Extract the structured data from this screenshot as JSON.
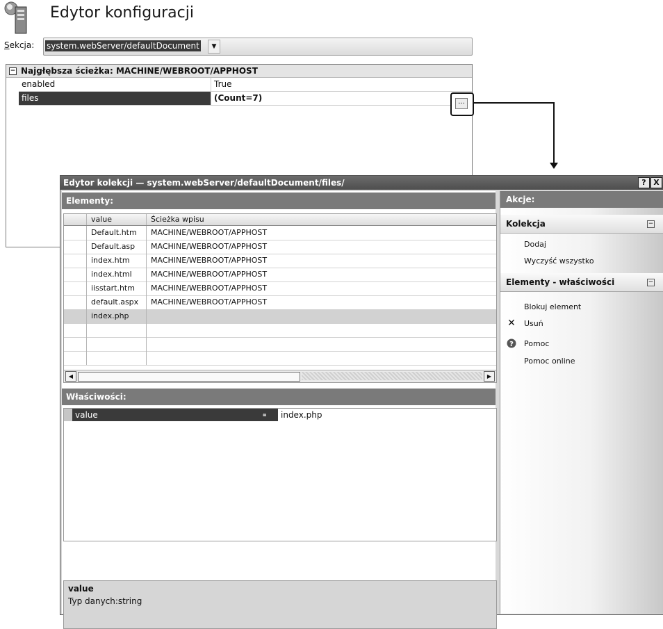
{
  "editor": {
    "title": "Edytor konfiguracji",
    "section_label_accel": "S",
    "section_label_rest": "ekcja:",
    "section_value": "system.webServer/defaultDocument",
    "tree_header": "Najgłębsza ścieżka: MACHINE/WEBROOT/APPHOST",
    "rows": [
      {
        "key": "enabled",
        "value": "True"
      },
      {
        "key": "files",
        "value": "(Count=7)"
      }
    ],
    "ellipsis": "..."
  },
  "dialog": {
    "title": "Edytor kolekcji — system.webServer/defaultDocument/files/",
    "help_btn": "?",
    "close_btn": "X",
    "elements_header": "Elementy:",
    "columns": [
      "value",
      "Ścieżka wpisu"
    ],
    "rows": [
      {
        "value": "Default.htm",
        "path": "MACHINE/WEBROOT/APPHOST"
      },
      {
        "value": "Default.asp",
        "path": "MACHINE/WEBROOT/APPHOST"
      },
      {
        "value": "index.htm",
        "path": "MACHINE/WEBROOT/APPHOST"
      },
      {
        "value": "index.html",
        "path": "MACHINE/WEBROOT/APPHOST"
      },
      {
        "value": "iisstart.htm",
        "path": "MACHINE/WEBROOT/APPHOST"
      },
      {
        "value": "default.aspx",
        "path": "MACHINE/WEBROOT/APPHOST"
      },
      {
        "value": "index.php",
        "path": ""
      }
    ],
    "properties_header": "Właściwości:",
    "property": {
      "key": "value",
      "value": "index.php"
    },
    "description": {
      "name": "value",
      "type": "Typ danych:string"
    }
  },
  "actions": {
    "header": "Akcje:",
    "group1": "Kolekcja",
    "group1_items": [
      "Dodaj",
      "Wyczyść wszystko"
    ],
    "group2": "Elementy - właściwości",
    "group2_items": [
      "Blokuj element",
      "Usuń"
    ],
    "help_items": [
      "Pomoc",
      "Pomoc online"
    ]
  }
}
